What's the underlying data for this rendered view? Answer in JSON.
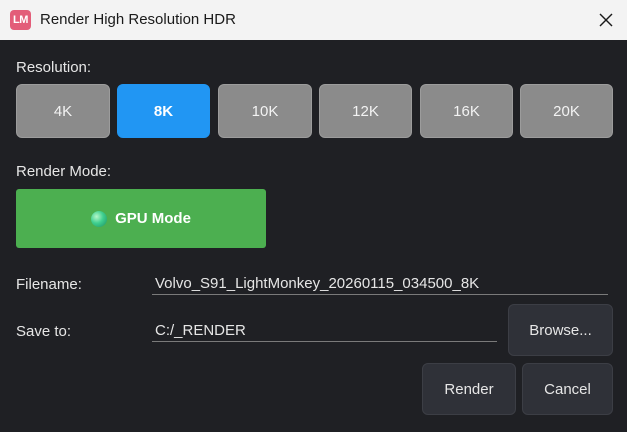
{
  "window": {
    "app_icon_text": "LM",
    "title": "Render High Resolution HDR"
  },
  "resolution": {
    "label": "Resolution:",
    "options": [
      "4K",
      "8K",
      "10K",
      "12K",
      "16K",
      "20K"
    ],
    "selected": "8K"
  },
  "render_mode": {
    "label": "Render Mode:",
    "button_label": "GPU Mode"
  },
  "filename": {
    "label": "Filename:",
    "value": "Volvo_S91_LightMonkey_20260115_034500_8K"
  },
  "save_to": {
    "label": "Save to:",
    "value": "C:/_RENDER",
    "browse_label": "Browse..."
  },
  "actions": {
    "render_label": "Render",
    "cancel_label": "Cancel"
  },
  "colors": {
    "accent_selected": "#2196f3",
    "gpu_mode": "#4caf50",
    "app_icon": "#e35d79",
    "background": "#1f2024"
  }
}
